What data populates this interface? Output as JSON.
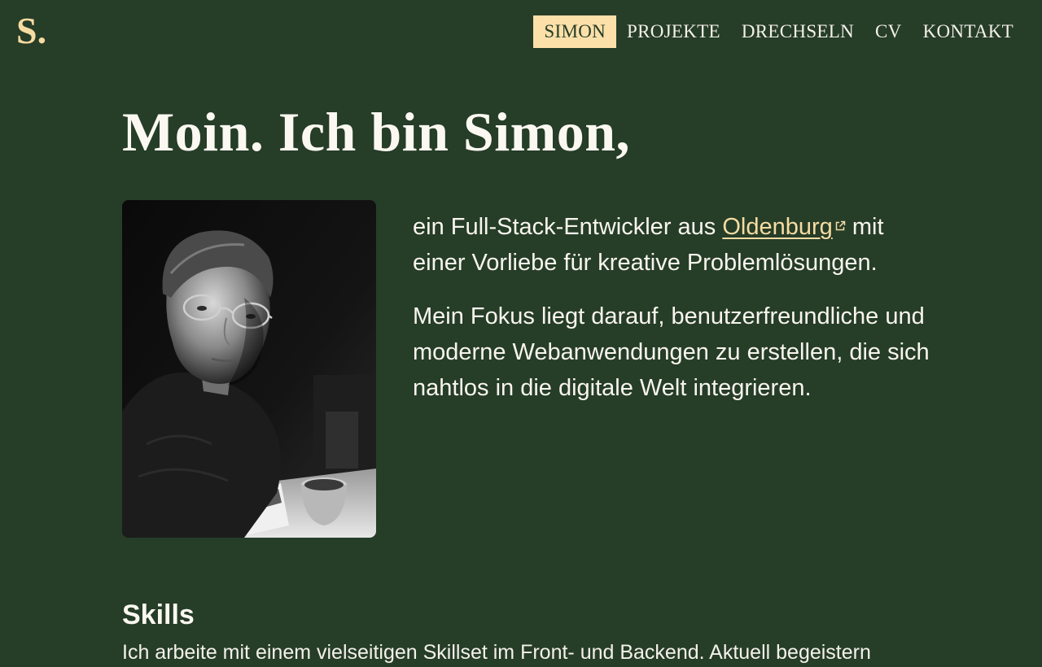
{
  "site": {
    "logo": "S."
  },
  "nav": {
    "items": [
      {
        "label": "SIMON",
        "active": true
      },
      {
        "label": "PROJEKTE",
        "active": false
      },
      {
        "label": "DRECHSELN",
        "active": false
      },
      {
        "label": "CV",
        "active": false
      },
      {
        "label": "KONTAKT",
        "active": false
      }
    ]
  },
  "hero": {
    "headline": "Moin. Ich bin Simon,",
    "portrait_icon": "portrait-photo",
    "intro_prefix": "ein Full-Stack-Entwickler aus ",
    "intro_link": "Oldenburg",
    "intro_link_icon": "external-link-icon",
    "intro_suffix": " mit einer Vorliebe für kreative Problemlösungen.",
    "paragraph2": "Mein Fokus liegt darauf, benutzerfreundliche und moderne Webanwendungen zu erstellen, die sich nahtlos in die digitale Welt integrieren."
  },
  "skills": {
    "title": "Skills",
    "text": "Ich arbeite mit einem vielseitigen Skillset im Front- und Backend. Aktuell begeistern"
  },
  "colors": {
    "background": "#263d28",
    "accent": "#f6dca2",
    "active_nav_bg": "#fce0a9",
    "text": "#f4f1ea"
  }
}
